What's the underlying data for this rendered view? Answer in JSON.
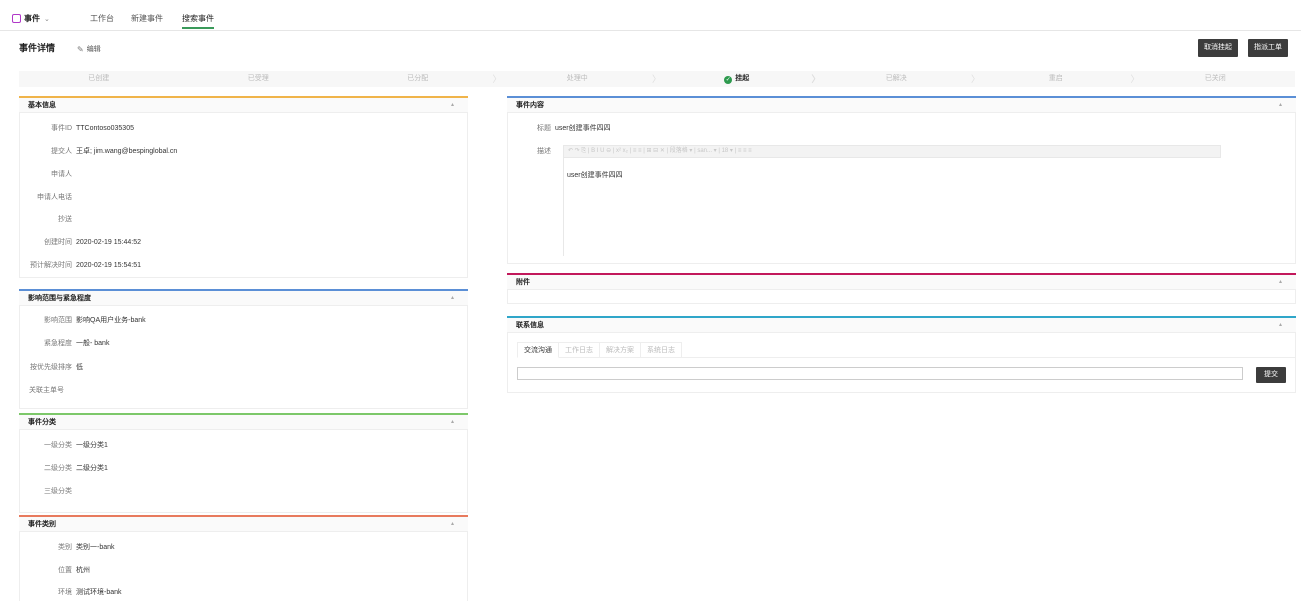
{
  "nav": {
    "app_label": "事件",
    "tabs": [
      "工作台",
      "新建事件",
      "搜索事件"
    ]
  },
  "header": {
    "title": "事件详情",
    "edit_label": "编辑",
    "cancel_hold_button": "取消挂起",
    "dispatch_button": "指派工单"
  },
  "steps": [
    "已创建",
    "已受理",
    "已分配",
    "处理中",
    "挂起",
    "已解决",
    "重启",
    "已关闭"
  ],
  "basic_info": {
    "title": "基本信息",
    "fields": [
      {
        "label": "事件ID",
        "value": "TTContoso035305"
      },
      {
        "label": "提交人",
        "value": "王卓; jim.wang@bespinglobal.cn"
      },
      {
        "label": "申请人",
        "value": ""
      },
      {
        "label": "申请人电话",
        "value": ""
      },
      {
        "label": "抄送",
        "value": ""
      },
      {
        "label": "创建时间",
        "value": "2020-02-19 15:44:52"
      },
      {
        "label": "预计解决时间",
        "value": "2020-02-19 15:54:51"
      }
    ]
  },
  "impact": {
    "title": "影响范围与紧急程度",
    "fields": [
      {
        "label": "影响范围",
        "value": "影响QA用户业务-bank"
      },
      {
        "label": "紧急程度",
        "value": "一般- bank"
      },
      {
        "label": "按优先级排序",
        "value": "低"
      },
      {
        "label": "关联主单号",
        "value": ""
      }
    ]
  },
  "category": {
    "title": "事件分类",
    "fields": [
      {
        "label": "一级分类",
        "value": "一级分类1"
      },
      {
        "label": "二级分类",
        "value": "二级分类1"
      },
      {
        "label": "三级分类",
        "value": ""
      }
    ]
  },
  "event_type": {
    "title": "事件类别",
    "fields": [
      {
        "label": "类别",
        "value": "类别一-bank"
      },
      {
        "label": "位置",
        "value": "杭州"
      },
      {
        "label": "环境",
        "value": "测试环境-bank"
      }
    ]
  },
  "content": {
    "title": "事件内容",
    "subject_label": "标题",
    "subject_value": "user创建事件四四",
    "desc_label": "描述",
    "toolbar_text": "↶ ↷ ⎘ | B I U ⊖ | x² x₂ | ≡ ≡ | ⊞ ⊟ ✕ | 段落格 ▾ | san... ▾ | 18 ▾ | ≡ ≡ ≡",
    "desc_value": "user创建事件四四"
  },
  "attachments": {
    "title": "附件"
  },
  "contact": {
    "title": "联系信息",
    "tabs": [
      "交流沟通",
      "工作日志",
      "解决方案",
      "系统日志"
    ],
    "submit_button": "提交"
  },
  "colors": {
    "basic": "#f0b44a",
    "impact": "#5b8fd6",
    "category": "#7dc86a",
    "event_type": "#e87a5d",
    "content": "#5b8fd6",
    "attachments": "#c2185b",
    "contact": "#2fa6c9"
  }
}
